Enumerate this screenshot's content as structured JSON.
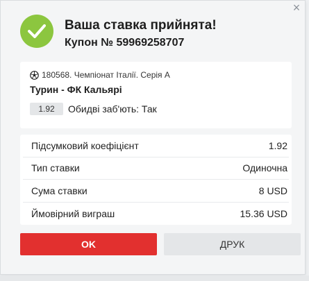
{
  "dialog": {
    "close_icon": "close-icon",
    "title": "Ваша ставка прийнята!",
    "coupon": "Купон № 59969258707",
    "status_color": "#8cc63f"
  },
  "bet": {
    "sport_icon": "soccer-ball-icon",
    "event": "180568. Чемпіонат Італії. Серія А",
    "teams": "Турин - ФК Кальярі",
    "odds": "1.92",
    "selection": "Обидві заб'ють: Так"
  },
  "summary": [
    {
      "label": "Підсумковий коефіцієнт",
      "value": "1.92"
    },
    {
      "label": "Тип ставки",
      "value": "Одиночна"
    },
    {
      "label": "Сума ставки",
      "value": "8 USD"
    },
    {
      "label": "Ймовірний виграш",
      "value": "15.36 USD"
    }
  ],
  "buttons": {
    "ok_label": "OK",
    "ok_color": "#e2302f",
    "print_label": "ДРУК"
  }
}
